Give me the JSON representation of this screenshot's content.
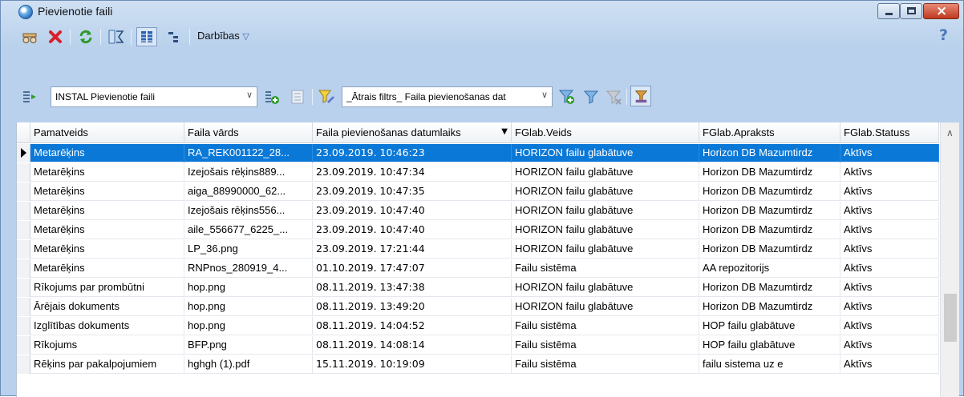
{
  "window": {
    "title": "Pievienotie faili"
  },
  "toolbar": {
    "actions_label": "Darbības",
    "actions_arrow": "▽",
    "help": "?"
  },
  "filterbar": {
    "view_select_value": "INSTAL Pievienotie faili",
    "filter_select_value": "_Ātrais filtrs_ Faila pievienošanas dat"
  },
  "colors": {
    "selected_row": "#0a78d7",
    "title_gradient": "#b9d1ec",
    "close_button": "#c0391f"
  },
  "table": {
    "sort_indicator": "▼",
    "columns": [
      "Pamatveids",
      "Faila vārds",
      "Faila pievienošanas datumlaiks",
      "FGlab.Veids",
      "FGlab.Apraksts",
      "FGlab.Statuss"
    ],
    "rows": [
      [
        "Metarēķins",
        "RA_REK001122_28...",
        "23.09.2019. 10:46:23",
        "HORIZON failu glabātuve",
        "Horizon DB Mazumtirdz",
        "Aktīvs"
      ],
      [
        "Metarēķins",
        "Izejošais rēķins889...",
        "23.09.2019. 10:47:34",
        "HORIZON failu glabātuve",
        "Horizon DB Mazumtirdz",
        "Aktīvs"
      ],
      [
        "Metarēķins",
        "aiga_88990000_62...",
        "23.09.2019. 10:47:35",
        "HORIZON failu glabātuve",
        "Horizon DB Mazumtirdz",
        "Aktīvs"
      ],
      [
        "Metarēķins",
        "Izejošais rēķins556...",
        "23.09.2019. 10:47:40",
        "HORIZON failu glabātuve",
        "Horizon DB Mazumtirdz",
        "Aktīvs"
      ],
      [
        "Metarēķins",
        "aile_556677_6225_...",
        "23.09.2019. 10:47:40",
        "HORIZON failu glabātuve",
        "Horizon DB Mazumtirdz",
        "Aktīvs"
      ],
      [
        "Metarēķins",
        "LP_36.png",
        "23.09.2019. 17:21:44",
        "HORIZON failu glabātuve",
        "Horizon DB Mazumtirdz",
        "Aktīvs"
      ],
      [
        "Metarēķins",
        "RNPnos_280919_4...",
        "01.10.2019. 17:47:07",
        "Failu sistēma",
        "AA repozitorijs",
        "Aktīvs"
      ],
      [
        "Rīkojums par prombūtni",
        "hop.png",
        "08.11.2019. 13:47:38",
        "HORIZON failu glabātuve",
        "Horizon DB Mazumtirdz",
        "Aktīvs"
      ],
      [
        "Ārējais dokuments",
        "hop.png",
        "08.11.2019. 13:49:20",
        "HORIZON failu glabātuve",
        "Horizon DB Mazumtirdz",
        "Aktīvs"
      ],
      [
        "Izglītības dokuments",
        "hop.png",
        "08.11.2019. 14:04:52",
        "Failu sistēma",
        "HOP failu glabātuve",
        "Aktīvs"
      ],
      [
        "Rīkojums",
        "BFP.png",
        "08.11.2019. 14:08:14",
        "Failu sistēma",
        "HOP failu glabātuve",
        "Aktīvs"
      ],
      [
        "Rēķins par pakalpojumiem",
        "hghgh (1).pdf",
        "15.11.2019. 10:19:09",
        "Failu sistēma",
        "failu sistema uz e",
        "Aktīvs"
      ]
    ]
  }
}
